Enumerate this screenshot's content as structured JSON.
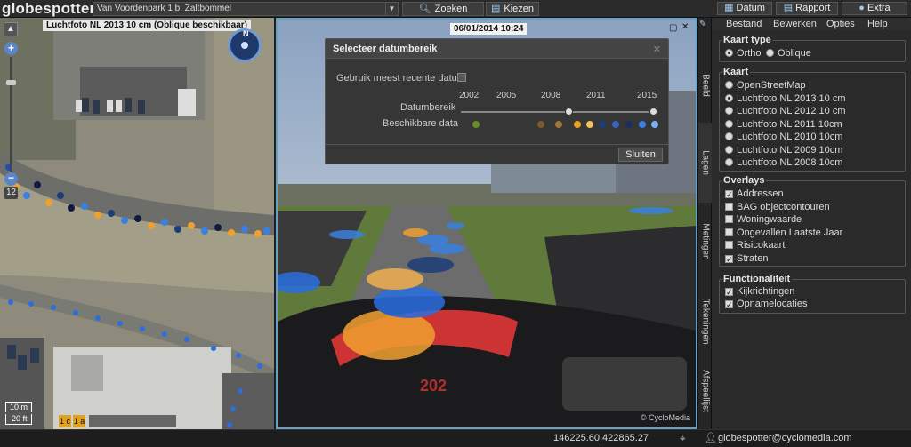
{
  "app": {
    "logo": "globespotter"
  },
  "toolbar": {
    "address": "Van Voordenpark  1 b, Zaltbommel",
    "search_label": "Zoeken",
    "choose_label": "Kiezen",
    "date_label": "Datum",
    "report_label": "Rapport",
    "extra_label": "Extra"
  },
  "menu": {
    "items": [
      "Bestand",
      "Bewerken",
      "Opties",
      "Help"
    ]
  },
  "map": {
    "layer_title": "Luchtfoto NL 2013 10 cm (Oblique beschikbaar)",
    "zoom_level": "12",
    "scale_top": "10 m",
    "scale_bottom": "20 ft",
    "badges": [
      "1 c",
      "1 a"
    ],
    "compass": "N"
  },
  "photo": {
    "timestamp": "06/01/2014 10:24",
    "watermark": "© CycloMedia",
    "vehicle_number": "202"
  },
  "dialog": {
    "title": "Selecteer datumbereik",
    "use_recent_label": "Gebruik meest recente datum",
    "range_label": "Datumbereik",
    "available_label": "Beschikbare data",
    "years": [
      "2002",
      "2005",
      "2008",
      "2011",
      "2015"
    ],
    "close_label": "Sluiten",
    "dot_colors": [
      "#6b8a2a",
      "#7a5a2a",
      "#a0783a",
      "#e8a020",
      "#f0c060",
      "#1d3c78",
      "#3a66b8",
      "#1a3060",
      "#3a80e0",
      "#7ab0f0"
    ]
  },
  "sidetabs": [
    "Beeld",
    "Lagen",
    "Metingen",
    "Tekeningen",
    "Afspeellijst"
  ],
  "panel": {
    "kaart_type": {
      "title": "Kaart type",
      "options": [
        "Ortho",
        "Oblique"
      ],
      "selected": 0
    },
    "kaart": {
      "title": "Kaart",
      "options": [
        "OpenStreetMap",
        "Luchtfoto NL 2013 10 cm",
        "Luchtfoto NL 2012 10 cm",
        "Luchtfoto NL 2011 10cm",
        "Luchtfoto NL 2010 10cm",
        "Luchtfoto NL 2009 10cm",
        "Luchtfoto NL 2008 10cm"
      ],
      "selected": 1
    },
    "overlays": {
      "title": "Overlays",
      "items": [
        {
          "label": "Addressen",
          "checked": true
        },
        {
          "label": "BAG objectcontouren",
          "checked": false
        },
        {
          "label": "Woningwaarde",
          "checked": false
        },
        {
          "label": "Ongevallen Laatste Jaar",
          "checked": false
        },
        {
          "label": "Risicokaart",
          "checked": false
        },
        {
          "label": "Straten",
          "checked": true
        }
      ]
    },
    "functionaliteit": {
      "title": "Functionaliteit",
      "items": [
        {
          "label": "Kijkrichtingen",
          "checked": true
        },
        {
          "label": "Opnamelocaties",
          "checked": true
        }
      ]
    }
  },
  "status": {
    "coordinates": "146225.60,422865.27",
    "user": "globespotter@cyclomedia.com"
  }
}
